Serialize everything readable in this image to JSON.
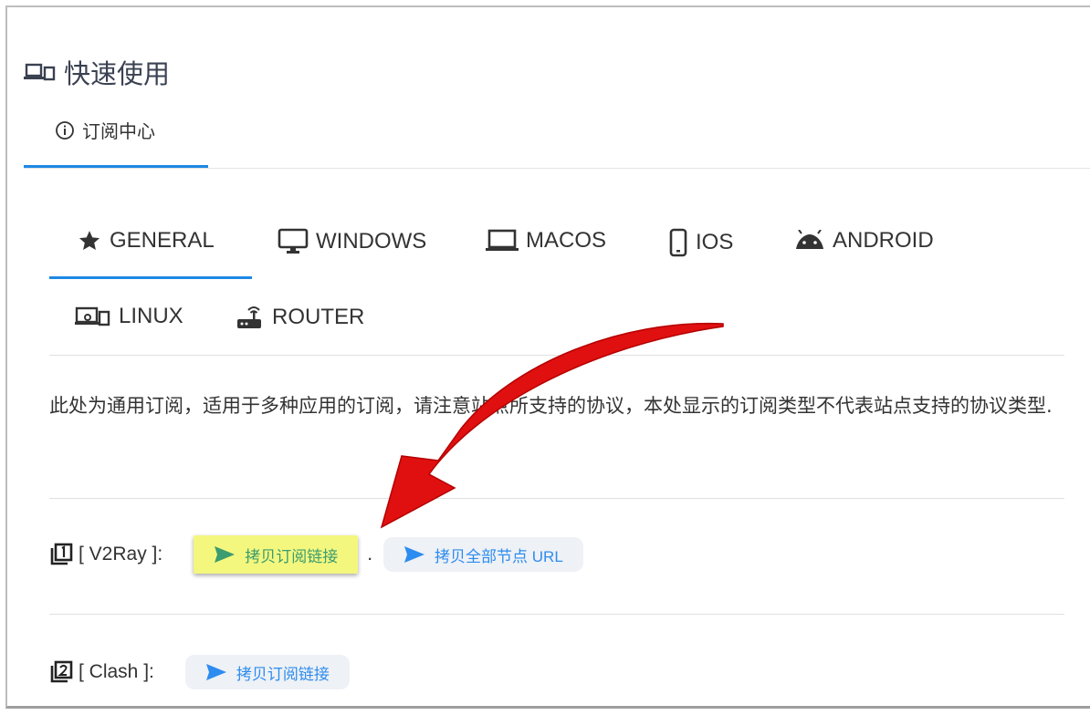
{
  "header": {
    "title": "快速使用",
    "icon": "devices-icon"
  },
  "subtab": {
    "label": "订阅中心",
    "icon": "info-icon"
  },
  "os_tabs": [
    {
      "label": "GENERAL",
      "icon": "star-icon"
    },
    {
      "label": "WINDOWS",
      "icon": "monitor-icon"
    },
    {
      "label": "MACOS",
      "icon": "laptop-icon"
    },
    {
      "label": "IOS",
      "icon": "phone-icon"
    },
    {
      "label": "ANDROID",
      "icon": "android-icon"
    },
    {
      "label": "LINUX",
      "icon": "linux-devices-icon"
    },
    {
      "label": "ROUTER",
      "icon": "router-icon"
    }
  ],
  "description": "此处为通用订阅，适用于多种应用的订阅，请注意站点所支持的协议，本处显示的订阅类型不代表站点支持的协议类型.",
  "subscriptions": [
    {
      "label": "[ V2Ray ]:",
      "copy_sub": "拷贝订阅链接",
      "separator": ".",
      "copy_nodes": "拷贝全部节点 URL"
    },
    {
      "label": "[ Clash ]:",
      "copy_sub": "拷贝订阅链接"
    }
  ],
  "colors": {
    "accent": "#1e88e5",
    "link": "#2d8cf0",
    "highlight": "#f4f77e",
    "arrow": "#e01010"
  }
}
